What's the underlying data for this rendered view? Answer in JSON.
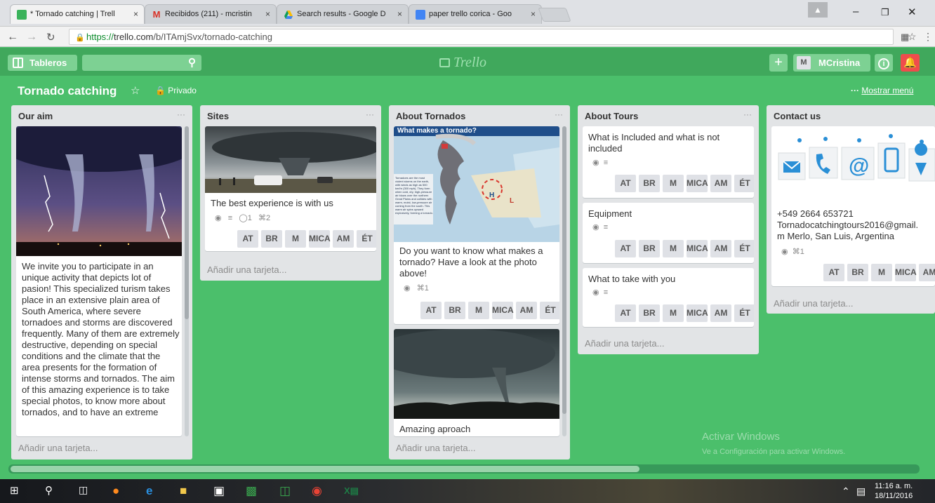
{
  "browser": {
    "tabs": [
      {
        "title": "* Tornado catching | Trell",
        "color": "#3bb35b"
      },
      {
        "title": "Recibidos (211) - mcristin",
        "color": "#d93025"
      },
      {
        "title": "Search results - Google D",
        "color": "#fbbc04"
      },
      {
        "title": "paper trello corica - Goo",
        "color": "#4285f4"
      }
    ],
    "close_glyph": "×",
    "url_prefix": "https://",
    "url_domain": "trello.com",
    "url_path": "/b/ITAmjSvx/tornado-catching"
  },
  "header": {
    "boards_label": "Tableros",
    "logo_text": "Trello",
    "plus_label": "+",
    "user_initial": "M",
    "user_name": "MCristina",
    "info_label": "i"
  },
  "board": {
    "title": "Tornado catching",
    "visibility": "Privado",
    "menu_label": "Mostrar menú",
    "menu_dots": "···"
  },
  "lists": {
    "aim": {
      "title": "Our aim",
      "card_text": "We invite you to participate in an unique activity that depicts lot of pasion! This specialized turism takes place in an extensive plain area of South America, where severe tornadoes and storms are discovered frequently. Many of them are extremely destructive, depending on special conditions and the climate that the area presents for the formation of intense storms and tornados. The aim of this amazing experience is to take special photos, to know more about tornados, and to have an extreme"
    },
    "sites": {
      "title": "Sites",
      "card_text": "The best experience is with us",
      "comments": "1",
      "attachments": "2"
    },
    "about_tornados": {
      "title": "About Tornados",
      "infographic_title": "What makes a tornado?",
      "infographic_caption": "Tornadoes are the most violent storms on the earth, with winds as high as 500 km/hr (300 mph). They form when cold, dry, high-pressure air blows over the northern Great Plains and collides with warm, moist, low-pressure air coming from the south. This warm air spins upward explosively, forming a tornado.",
      "label_h": "H",
      "label_l": "L",
      "card1_text": "Do you want to know what makes a tornado? Have a look at the photo above!",
      "card1_attachments": "1",
      "card2_text": "Amazing aproach"
    },
    "about_tours": {
      "title": "About Tours",
      "cards": [
        {
          "text": "What is Included and what is not included"
        },
        {
          "text": "Equipment"
        },
        {
          "text": "What to take with you"
        }
      ]
    },
    "contact": {
      "title": "Contact us",
      "phone": "+549 2664 653721",
      "email": "Tornadocatchingtours2016@gmail.",
      "address": "m Merlo, San Luis, Argentina",
      "attachments": "1"
    }
  },
  "members": [
    "AT",
    "BR",
    "M",
    "MICA",
    "AM",
    "ÉT"
  ],
  "add_card_label": "Añadir una tarjeta...",
  "watermark": {
    "line1": "Activar Windows",
    "line2": "Ve a Configuración para activar Windows."
  },
  "taskbar": {
    "time": "11:16 a. m.",
    "date": "18/11/2016"
  },
  "colors": {
    "board_bg": "#4bbf6b",
    "header_bg": "#40a85c",
    "notification_red": "#ef4c4c"
  }
}
